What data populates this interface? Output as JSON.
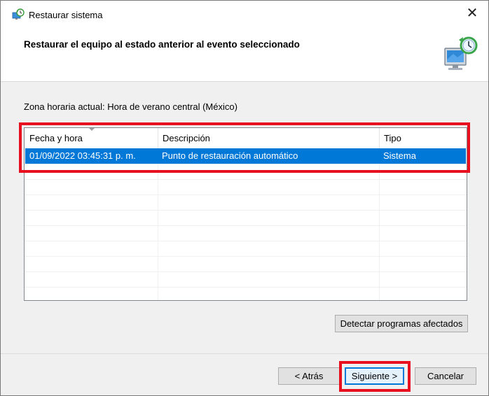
{
  "window": {
    "title": "Restaurar sistema",
    "close_glyph": "✕"
  },
  "header": {
    "title": "Restaurar el equipo al estado anterior al evento seleccionado",
    "graphic_icon": "system-restore-icon"
  },
  "timezone_label": "Zona horaria actual: Hora de verano central (México)",
  "restore_points": {
    "columns": [
      "Fecha y hora",
      "Descripción",
      "Tipo"
    ],
    "rows": [
      {
        "date": "01/09/2022 03:45:31 p. m.",
        "description": "Punto de restauración automático",
        "type": "Sistema",
        "selected": true
      }
    ]
  },
  "buttons": {
    "detect": "Detectar programas afectados",
    "back": "< Atrás",
    "next": "Siguiente >",
    "cancel": "Cancelar"
  },
  "colors": {
    "selection": "#0078d7",
    "highlight": "#e8101e"
  }
}
